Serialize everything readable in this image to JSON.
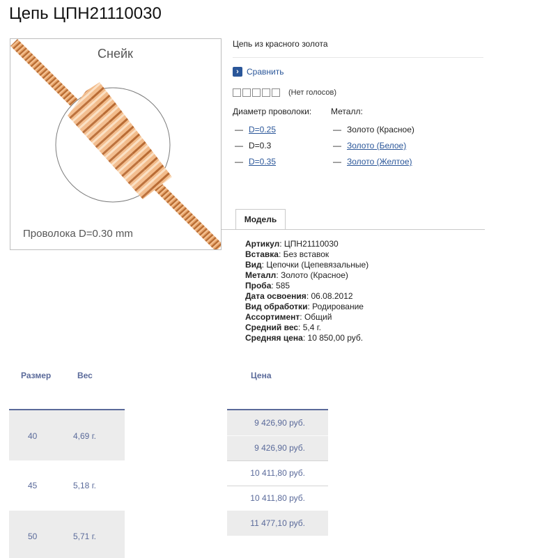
{
  "page": {
    "title": "Цепь ЦПН21110030"
  },
  "image": {
    "name": "Снейк",
    "caption": "Проволока D=0.30 mm"
  },
  "info": {
    "subtitle": "Цепь из красного золота",
    "compare_label": "Сравнить",
    "rating_text": "(Нет голосов)",
    "diameter_label": "Диаметр проволоки:",
    "metal_label": "Металл:",
    "diameter_options": [
      {
        "label": "D=0.25",
        "link": true
      },
      {
        "label": "D=0.3",
        "link": false
      },
      {
        "label": "D=0.35",
        "link": true
      }
    ],
    "metal_options": [
      {
        "label": "Золото (Красное)",
        "link": false
      },
      {
        "label": "Золото (Белое)",
        "link": true
      },
      {
        "label": "Золото (Желтое)",
        "link": true
      }
    ]
  },
  "tab": {
    "label": "Модель"
  },
  "specs": [
    {
      "key": "Артикул",
      "value": "ЦПН21110030"
    },
    {
      "key": "Вставка",
      "value": "Без вставок"
    },
    {
      "key": "Вид",
      "value": "Цепочки (Цепевязальные)"
    },
    {
      "key": "Металл",
      "value": "Золото (Красное)"
    },
    {
      "key": "Проба",
      "value": "585"
    },
    {
      "key": "Дата освоения",
      "value": "06.08.2012"
    },
    {
      "key": "Вид обработки",
      "value": "Родирование"
    },
    {
      "key": "Ассортимент",
      "value": "Общий"
    },
    {
      "key": "Средний вес",
      "value": "5,4 г."
    },
    {
      "key": "Средняя цена",
      "value": "10 850,00 руб."
    }
  ],
  "table": {
    "headers": {
      "size": "Размер",
      "weight": "Вес",
      "price": "Цена"
    },
    "rows": [
      {
        "size": "40",
        "weight": "4,69 г."
      },
      {
        "size": "45",
        "weight": "5,18 г."
      },
      {
        "size": "50",
        "weight": "5,71 г."
      }
    ],
    "prices": [
      "9 426,90 руб.",
      "9 426,90 руб.",
      "10 411,80 руб.",
      "10 411,80 руб.",
      "11 477,10 руб."
    ]
  },
  "colors": {
    "link": "#2a5699",
    "table_text": "#5a6a9a",
    "gold": "#e8a46a"
  }
}
